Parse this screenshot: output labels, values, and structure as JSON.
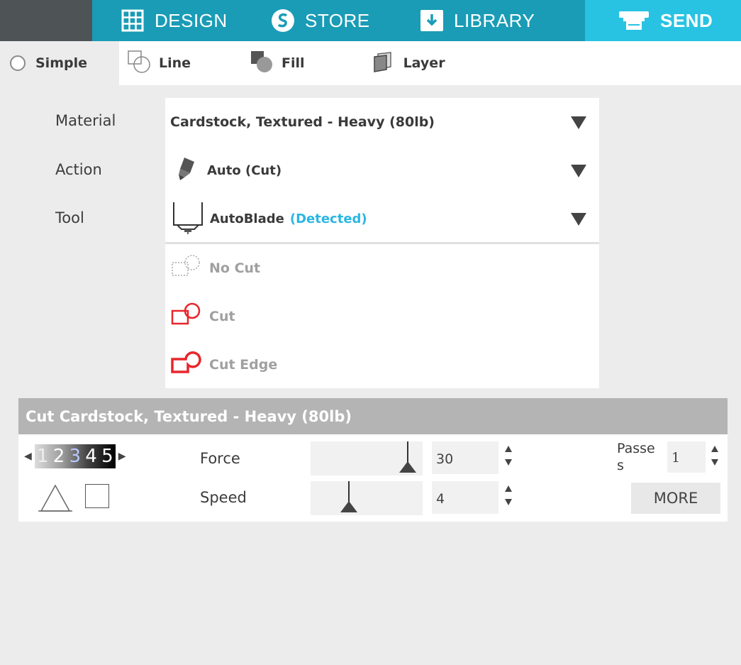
{
  "nav": {
    "tabs": [
      {
        "label": "DESIGN",
        "icon": "grid-icon"
      },
      {
        "label": "STORE",
        "icon": "store-s-icon"
      },
      {
        "label": "LIBRARY",
        "icon": "download-icon"
      },
      {
        "label": "SEND",
        "icon": "printer-icon",
        "active": true
      }
    ]
  },
  "subtabs": {
    "simple": "Simple",
    "line": "Line",
    "fill": "Fill",
    "layer": "Layer"
  },
  "settings": {
    "material_label": "Material",
    "action_label": "Action",
    "tool_label": "Tool",
    "material_value": "Cardstock, Textured - Heavy (80lb)",
    "action_value": "Auto (Cut)",
    "tool_value": "AutoBlade",
    "tool_status": "(Detected)"
  },
  "cut_options": [
    "No Cut",
    "Cut",
    "Cut Edge"
  ],
  "cut_panel": {
    "title": "Cut Cardstock, Textured - Heavy (80lb)",
    "blade_digits": [
      "1",
      "2",
      "3",
      "4",
      "5"
    ],
    "force_label": "Force",
    "force_value": "30",
    "force_level": 0.87,
    "speed_label": "Speed",
    "speed_value": "4",
    "speed_level": 0.34,
    "passes_label": "Passe s",
    "passes_value": "1",
    "more_label": "MORE"
  },
  "colors": {
    "nav_bg": "#1a9cb6",
    "nav_active": "#28c3e2",
    "detected": "#2bb6e3",
    "cut_red": "#e8262b"
  }
}
